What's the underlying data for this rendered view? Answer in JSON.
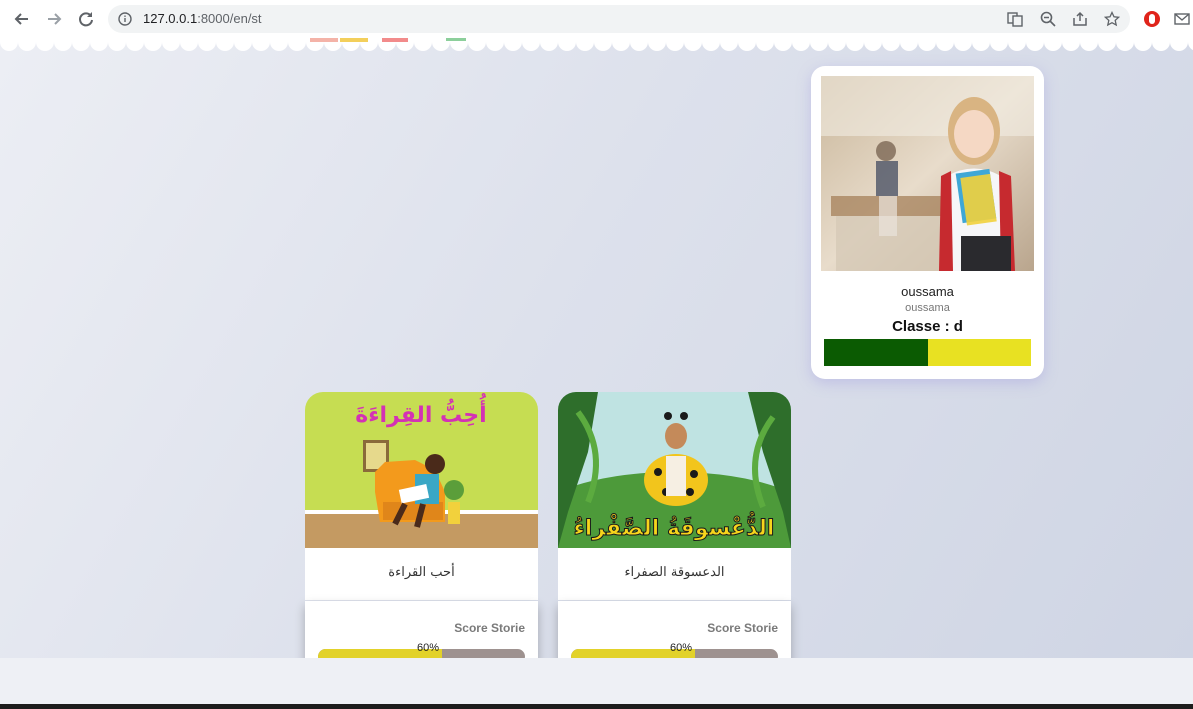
{
  "browser": {
    "url_host": "127.0.0.1",
    "url_path": ":8000/en/st",
    "icons": [
      "back-icon",
      "forward-icon",
      "reload-icon",
      "info-icon",
      "translate-icon",
      "zoom-icon",
      "share-icon",
      "star-icon",
      "extension-icon",
      "mail-icon"
    ]
  },
  "profile": {
    "name": "oussama",
    "username": "oussama",
    "class_label": "Classe : d",
    "progress": 0.5,
    "colors": {
      "fill": "#0b5b02",
      "rest": "#e8e122"
    }
  },
  "stories": [
    {
      "title": "أحب القراءة",
      "cover_text": "أُحِبُّ القِراءَةَ",
      "score_label": "Score Storie",
      "score_text": "60%",
      "score": 0.6
    },
    {
      "title": "الدعسوقة الصفراء",
      "cover_text": "الدُّعْسوقَةُ الصَّفْراءُ",
      "score_label": "Score Storie",
      "score_text": "60%",
      "score": 0.6
    }
  ]
}
